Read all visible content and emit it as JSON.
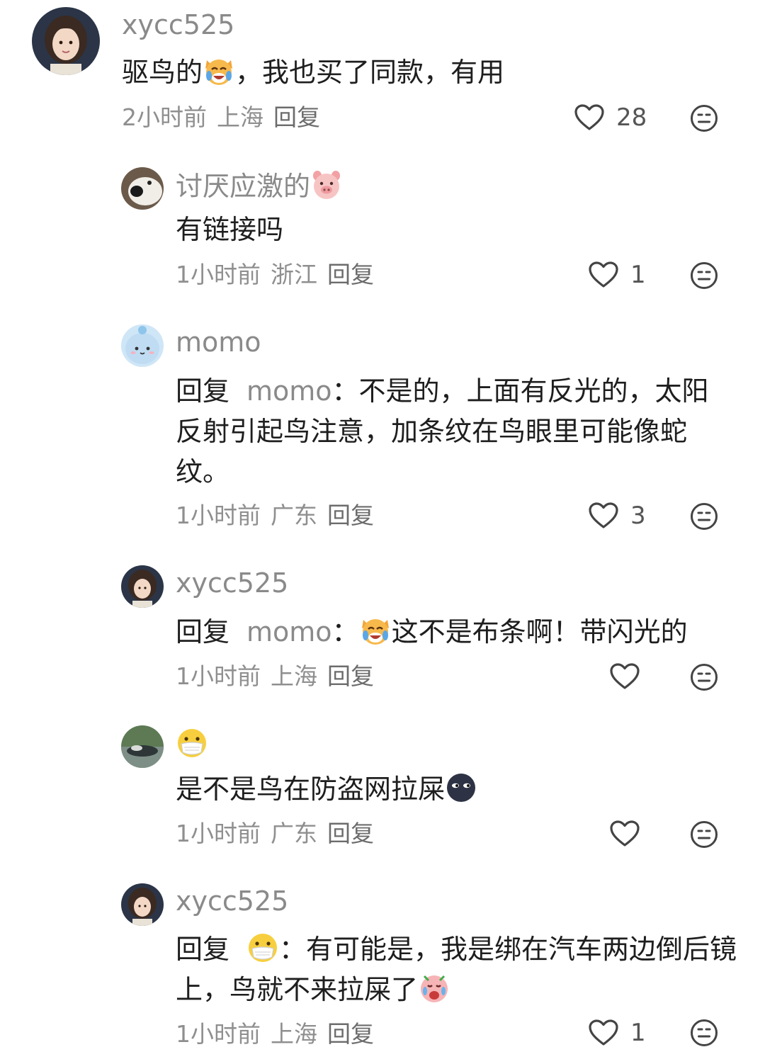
{
  "comments": [
    {
      "username": "xycc525",
      "content_before": "驱鸟的",
      "content_emoji": "crying-laughing-cat-emoji",
      "content_after": "，我也买了同款，有用",
      "time": "2小时前",
      "location": "上海",
      "reply_label": "回复",
      "likes": "28"
    },
    {
      "username": "讨厌应激的",
      "username_emoji": "pig-face-emoji",
      "content": "有链接吗",
      "time": "1小时前",
      "location": "浙江",
      "reply_label": "回复",
      "likes": "1"
    },
    {
      "username": "momo",
      "reply_prefix": "回复",
      "mention": "momo",
      "content": "：不是的，上面有反光的，太阳反射引起鸟注意，加条纹在鸟眼里可能像蛇纹。",
      "time": "1小时前",
      "location": "广东",
      "reply_label": "回复",
      "likes": "3"
    },
    {
      "username": "xycc525",
      "reply_prefix": "回复",
      "mention": "momo",
      "content_colon": "：",
      "content_emoji": "crying-laughing-cat-emoji",
      "content": "这不是布条啊！带闪光的",
      "time": "1小时前",
      "location": "上海",
      "reply_label": "回复"
    },
    {
      "username_emoji": "mask-face-emoji",
      "content": "是不是鸟在防盗网拉屎",
      "content_emoji": "dark-face-emoji",
      "time": "1小时前",
      "location": "广东",
      "reply_label": "回复"
    },
    {
      "username": "xycc525",
      "reply_prefix": "回复",
      "mention_emoji": "mask-face-emoji",
      "content": "：有可能是，我是绑在汽车两边倒后镜上，鸟就不来拉屎了",
      "content_emoji": "crying-pig-emoji",
      "time": "1小时前",
      "location": "上海",
      "reply_label": "回复",
      "likes": "1"
    }
  ],
  "icons": {
    "like": "heart-outline-icon",
    "dislike": "neutral-face-icon"
  }
}
